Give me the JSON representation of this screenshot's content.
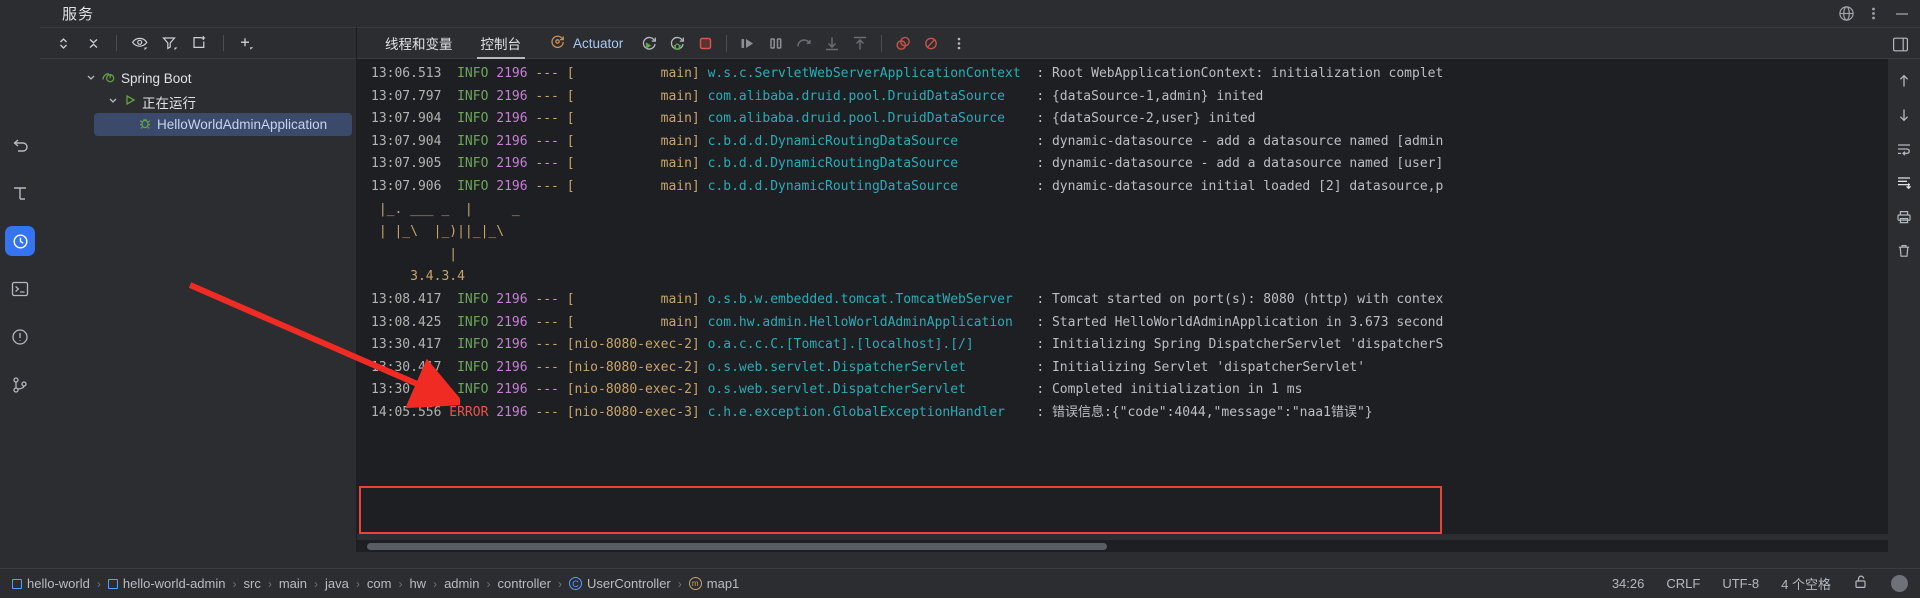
{
  "window": {
    "tool_title": "服务",
    "icons": [
      "globe-icon",
      "more-vertical-icon",
      "minimize-icon"
    ]
  },
  "left_strip": {
    "items": [
      {
        "name": "undo-icon",
        "label": ""
      },
      {
        "name": "structure-icon",
        "label": ""
      },
      {
        "name": "debug-icon",
        "label": "",
        "active": true
      },
      {
        "name": "terminal-icon",
        "label": ""
      },
      {
        "name": "problems-icon",
        "label": ""
      },
      {
        "name": "version-control-icon",
        "label": ""
      }
    ]
  },
  "services_panel": {
    "toolbar": [
      "expand-collapse-icon",
      "collapse-all-icon",
      "eye-icon",
      "filter-icon",
      "add-tab-icon",
      "plus-icon"
    ],
    "tree": [
      {
        "label": "Spring Boot",
        "level": 1,
        "icon": "spring-boot-icon",
        "expanded": true,
        "selected": false
      },
      {
        "label": "正在运行",
        "level": 2,
        "icon": "run-icon",
        "expanded": true,
        "selected": false
      },
      {
        "label": "HelloWorldAdminApplication",
        "level": 3,
        "icon": "bug-icon",
        "expanded": false,
        "selected": true
      }
    ]
  },
  "console": {
    "tabs": [
      {
        "label": "线程和变量",
        "active": false
      },
      {
        "label": "控制台",
        "active": true
      }
    ],
    "actuator_label": "Actuator",
    "buttons": [
      "rerun-icon",
      "rerun-debug-icon",
      "stop-icon",
      "resume-icon",
      "pause-icon",
      "step-over-icon",
      "step-into-icon",
      "step-out-icon",
      "mute-breakpoints-icon",
      "view-breakpoints-icon",
      "more-options-icon"
    ],
    "gutter_icons": [
      "scroll-up-icon",
      "scroll-down-icon",
      "soft-wrap-icon",
      "scroll-to-end-icon",
      "print-icon",
      "clear-all-icon"
    ],
    "lines": [
      {
        "type": "log",
        "time": "13:06.513",
        "level": "INFO",
        "pid": "2196",
        "thread": "main",
        "cls": "w.s.c.ServletWebServerApplicationContext",
        "msg": "Root WebApplicationContext: initialization complet"
      },
      {
        "type": "log",
        "time": "13:07.797",
        "level": "INFO",
        "pid": "2196",
        "thread": "main",
        "cls": "com.alibaba.druid.pool.DruidDataSource",
        "msg": "{dataSource-1,admin} inited"
      },
      {
        "type": "log",
        "time": "13:07.904",
        "level": "INFO",
        "pid": "2196",
        "thread": "main",
        "cls": "com.alibaba.druid.pool.DruidDataSource",
        "msg": "{dataSource-2,user} inited"
      },
      {
        "type": "log",
        "time": "13:07.904",
        "level": "INFO",
        "pid": "2196",
        "thread": "main",
        "cls": "c.b.d.d.DynamicRoutingDataSource",
        "msg": "dynamic-datasource - add a datasource named [admin"
      },
      {
        "type": "log",
        "time": "13:07.905",
        "level": "INFO",
        "pid": "2196",
        "thread": "main",
        "cls": "c.b.d.d.DynamicRoutingDataSource",
        "msg": "dynamic-datasource - add a datasource named [user]"
      },
      {
        "type": "log",
        "time": "13:07.906",
        "level": "INFO",
        "pid": "2196",
        "thread": "main",
        "cls": "c.b.d.d.DynamicRoutingDataSource",
        "msg": "dynamic-datasource initial loaded [2] datasource,p"
      },
      {
        "type": "banner",
        "text": " |_. ___ _  |     _"
      },
      {
        "type": "banner",
        "text": " | |_\\  |_)||_|_\\"
      },
      {
        "type": "banner",
        "text": "          |"
      },
      {
        "type": "banner",
        "text": "     3.4.3.4"
      },
      {
        "type": "log",
        "time": "13:08.417",
        "level": "INFO",
        "pid": "2196",
        "thread": "main",
        "cls": "o.s.b.w.embedded.tomcat.TomcatWebServer",
        "msg": "Tomcat started on port(s): 8080 (http) with contex"
      },
      {
        "type": "log",
        "time": "13:08.425",
        "level": "INFO",
        "pid": "2196",
        "thread": "main",
        "cls": "com.hw.admin.HelloWorldAdminApplication",
        "msg": "Started HelloWorldAdminApplication in 3.673 second"
      },
      {
        "type": "log",
        "time": "13:30.417",
        "level": "INFO",
        "pid": "2196",
        "thread": "nio-8080-exec-2",
        "cls": "o.a.c.c.C.[Tomcat].[localhost].[/]",
        "msg": "Initializing Spring DispatcherServlet 'dispatcherS"
      },
      {
        "type": "log",
        "time": "13:30.417",
        "level": "INFO",
        "pid": "2196",
        "thread": "nio-8080-exec-2",
        "cls": "o.s.web.servlet.DispatcherServlet",
        "msg": "Initializing Servlet 'dispatcherServlet'"
      },
      {
        "type": "log",
        "time": "13:30.418",
        "level": "INFO",
        "pid": "2196",
        "thread": "nio-8080-exec-2",
        "cls": "o.s.web.servlet.DispatcherServlet",
        "msg": "Completed initialization in 1 ms"
      },
      {
        "type": "log",
        "time": "14:05.556",
        "level": "ERROR",
        "pid": "2196",
        "thread": "nio-8080-exec-3",
        "cls": "c.h.e.exception.GlobalExceptionHandler",
        "msg": "错误信息:{\"code\":4044,\"message\":\"naa1错误\"}"
      }
    ]
  },
  "status_bar": {
    "breadcrumbs": [
      {
        "label": "hello-world",
        "icon": "module-icon"
      },
      {
        "label": "hello-world-admin",
        "icon": "module-icon"
      },
      {
        "label": "src",
        "icon": ""
      },
      {
        "label": "main",
        "icon": ""
      },
      {
        "label": "java",
        "icon": ""
      },
      {
        "label": "com",
        "icon": ""
      },
      {
        "label": "hw",
        "icon": ""
      },
      {
        "label": "admin",
        "icon": ""
      },
      {
        "label": "controller",
        "icon": ""
      },
      {
        "label": "UserController",
        "icon": "class-icon"
      },
      {
        "label": "map1",
        "icon": "method-icon"
      }
    ],
    "separator": "›",
    "caret": "34:26",
    "line_sep": "CRLF",
    "encoding": "UTF-8",
    "indent": "4 个空格",
    "lock": "unlocked-icon"
  },
  "colors": {
    "accent": "#3574f0",
    "error": "#e8443a",
    "info": "#6ca65a",
    "class": "#2aacb8",
    "pid": "#c77fd6",
    "thread": "#c8a46a",
    "console_bg": "#1e1f22",
    "panel_bg": "#2b2d30"
  }
}
